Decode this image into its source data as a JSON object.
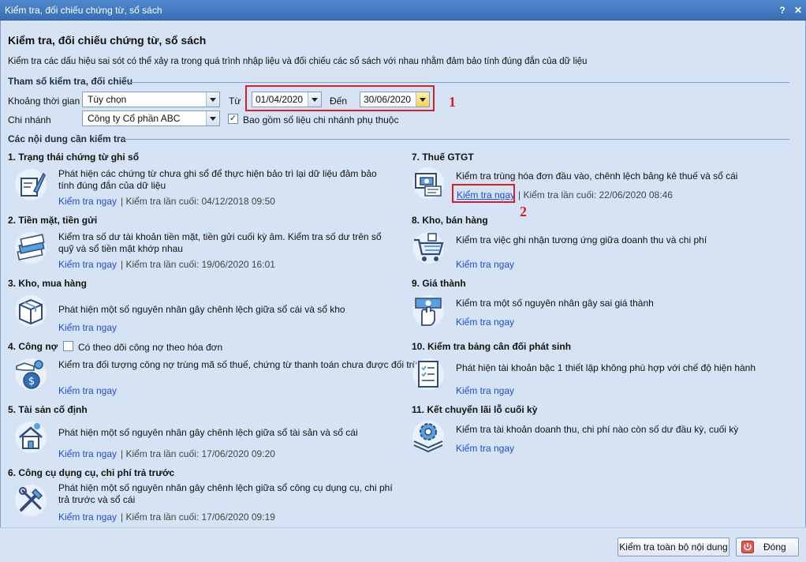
{
  "window": {
    "title": "Kiểm tra, đối chiếu chứng từ, sổ sách",
    "help": "?",
    "close": "✕"
  },
  "header": {
    "title": "Kiểm tra, đối chiếu chứng từ, sổ sách",
    "description": "Kiểm tra các dấu hiệu sai sót có thể xảy ra trong quá trình nhập liệu và đối chiếu các sổ sách với nhau nhằm đảm bảo tính đúng đắn của dữ liệu"
  },
  "params": {
    "section": "Tham số kiểm tra, đối chiếu",
    "period_label": "Khoảng thời gian",
    "period_value": "Tùy chọn",
    "from_label": "Từ",
    "from_value": "01/04/2020",
    "to_label": "Đến",
    "to_value": "30/06/2020",
    "branch_label": "Chi nhánh",
    "branch_value": "Công ty Cổ phần ABC",
    "include_label": "Bao gồm số liệu chi nhánh phụ thuộc",
    "include_checked": true
  },
  "annotations": {
    "one": "1",
    "two": "2"
  },
  "content_section": "Các nội dung cần kiểm tra",
  "items": [
    {
      "title": "1. Trạng thái chứng từ ghi sổ",
      "desc": "Phát hiện các chứng từ chưa ghi sổ để thực hiện bảo trì lại dữ liệu đảm bảo tính đúng đắn của dữ liệu",
      "link": "Kiểm tra ngay",
      "last": "| Kiểm tra lần cuối: 04/12/2018 09:50",
      "icon": "feather-document-icon"
    },
    {
      "title": "2. Tiền mặt, tiền gửi",
      "desc": "Kiểm tra số dư tài khoản tiền mặt, tiền gửi cuối kỳ âm. Kiểm tra số dư trên sổ quỹ và sổ tiền mặt khớp nhau",
      "link": "Kiểm tra ngay",
      "last": "| Kiểm tra lần cuối: 19/06/2020 16:01",
      "icon": "cash-stack-icon"
    },
    {
      "title": "3. Kho, mua hàng",
      "desc": "Phát hiện một số nguyên nhân gây chênh lệch giữa sổ cái và sổ kho",
      "link": "Kiểm tra ngay",
      "last": "",
      "icon": "box-icon"
    },
    {
      "title": "4. Công nợ",
      "desc": "Kiểm tra đối tượng công nợ trùng mã số thuế, chứng từ thanh toán chưa được đối trừ hết",
      "link": "Kiểm tra ngay",
      "last": "",
      "icon": "money-bag-hand-icon",
      "option": "Có theo dõi công nợ theo hóa đơn"
    },
    {
      "title": "5. Tài sản cố định",
      "desc": "Phát hiện một số nguyên nhân gây chênh lệch giữa sổ tài sản và sổ cái",
      "link": "Kiểm tra ngay",
      "last": "| Kiểm tra lần cuối: 17/06/2020 09:20",
      "icon": "house-icon"
    },
    {
      "title": "6. Công cụ dụng cụ, chi phí trả trước",
      "desc": "Phát hiện một số nguyên nhân gây chênh lệch giữa sổ công cụ dụng cụ, chi phí trả trước và sổ cái",
      "link": "Kiểm tra ngay",
      "last": "| Kiểm tra lần cuối: 17/06/2020 09:19",
      "icon": "tools-icon"
    },
    {
      "title": "7. Thuế GTGT",
      "desc": "Kiểm tra trùng hóa đơn đầu vào, chênh lệch bảng kê thuế và sổ cái",
      "link": "Kiểm tra ngay",
      "last": "| Kiểm tra lần cuối: 22/06/2020 08:46",
      "icon": "invoice-icon"
    },
    {
      "title": "8. Kho, bán hàng",
      "desc": "Kiểm tra việc ghi nhận tương ứng giữa doanh thu và chi phí",
      "link": "Kiểm tra ngay",
      "last": "",
      "icon": "shopping-cart-icon"
    },
    {
      "title": "9. Giá thành",
      "desc": "Kiểm tra một số nguyên nhân gây sai giá thành",
      "link": "Kiểm tra ngay",
      "last": "",
      "icon": "hand-money-icon"
    },
    {
      "title": "10. Kiểm tra bảng cân đối phát sinh",
      "desc": "Phát hiện tài khoản bậc 1 thiết lập không phù hợp với chế độ hiện hành",
      "link": "Kiểm tra ngay",
      "last": "",
      "icon": "checklist-icon"
    },
    {
      "title": "11. Kết chuyển lãi lỗ cuối kỳ",
      "desc": "Kiểm tra tài khoản doanh thu, chi phí nào còn số dư đầu kỳ, cuối kỳ",
      "link": "Kiểm tra ngay",
      "last": "",
      "icon": "gear-layers-icon"
    }
  ],
  "footer": {
    "check_all": "Kiểm tra toàn bộ nội dung",
    "close": "Đóng"
  },
  "colors": {
    "accent": "#3a6fb6",
    "background": "#d6e3f4",
    "link": "#1d4ed8",
    "highlight": "#d3202a"
  }
}
